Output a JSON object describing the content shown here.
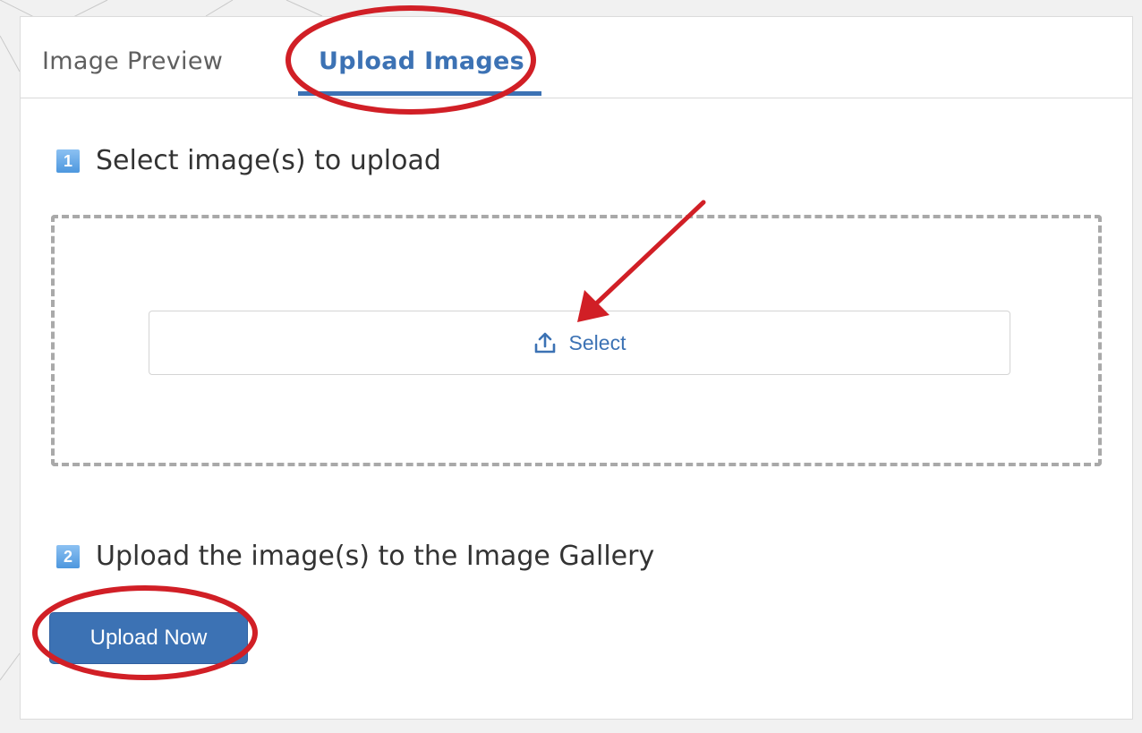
{
  "tabs": {
    "preview_label": "Image Preview",
    "upload_label": "Upload Images",
    "active": "Upload Images"
  },
  "step1": {
    "number": "1",
    "label": "Select image(s) to upload"
  },
  "dropzone": {
    "select_label": "Select",
    "icon": "upload-icon"
  },
  "step2": {
    "number": "2",
    "label": "Upload the image(s) to the Image Gallery"
  },
  "upload_button": {
    "label": "Upload Now"
  },
  "colors": {
    "accent": "#3c72b4",
    "annotation": "#d11f26",
    "step_badge": "#5ba3e6"
  }
}
